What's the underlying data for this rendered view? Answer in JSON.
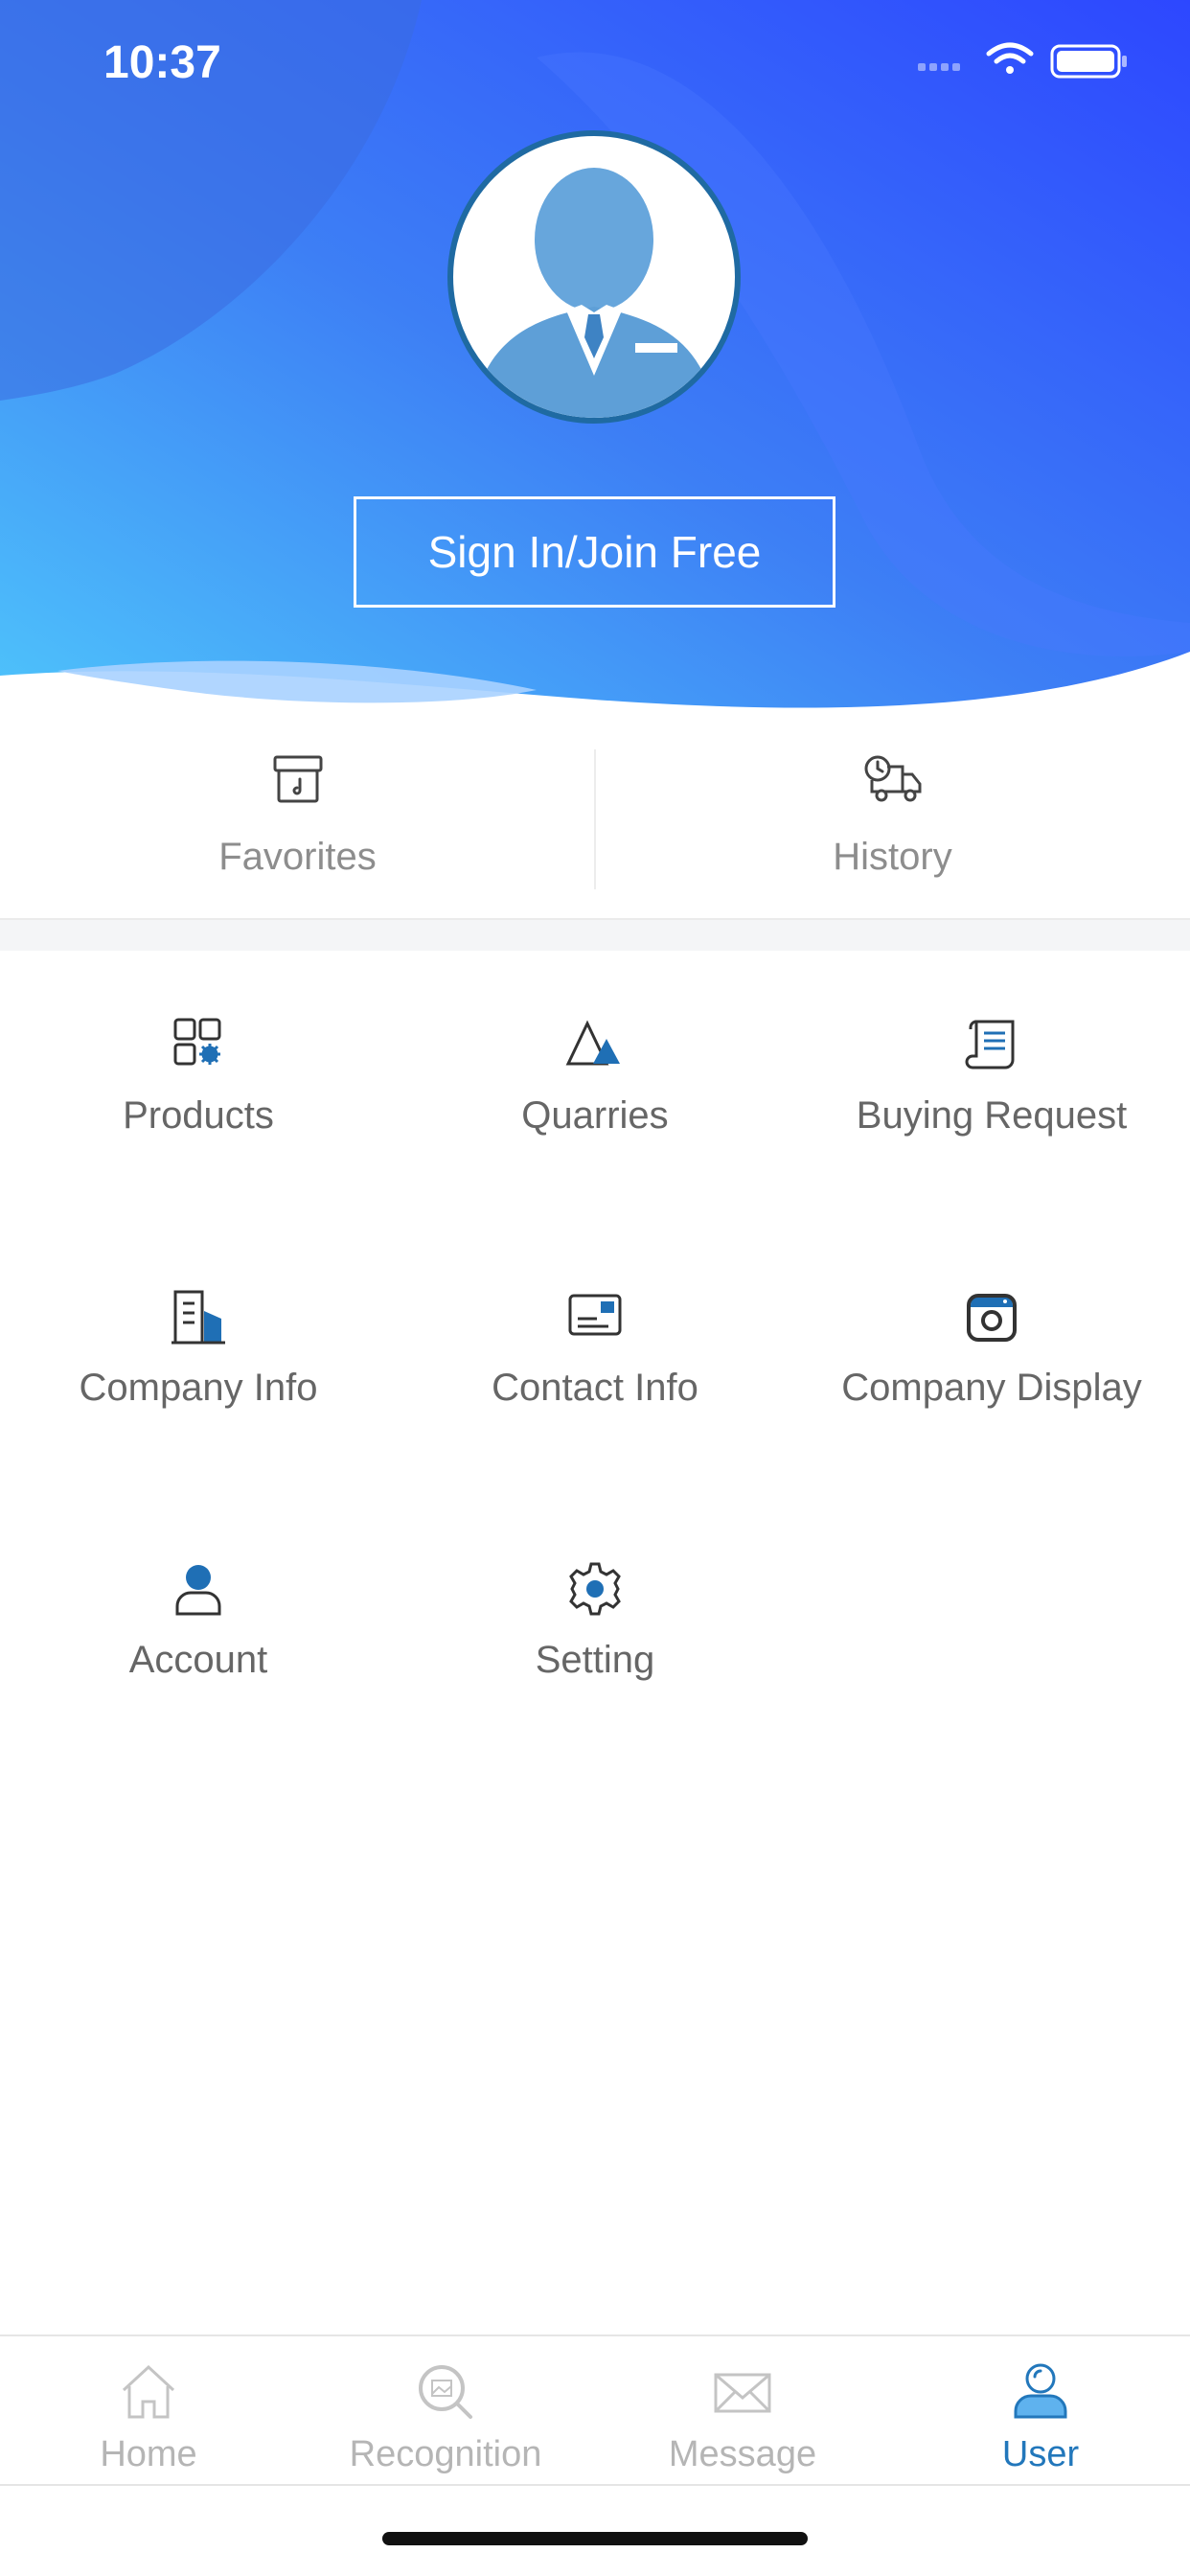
{
  "status_bar": {
    "time": "10:37"
  },
  "header": {
    "signin_label": "Sign In/Join Free"
  },
  "quick_links": [
    {
      "label": "Favorites",
      "icon": "archive-box-icon"
    },
    {
      "label": "History",
      "icon": "delivery-truck-clock-icon"
    }
  ],
  "menu": [
    {
      "label": "Products",
      "icon": "grid-gear-icon"
    },
    {
      "label": "Quarries",
      "icon": "mountain-icon"
    },
    {
      "label": "Buying Request",
      "icon": "scroll-document-icon"
    },
    {
      "label": "Company Info",
      "icon": "building-icon"
    },
    {
      "label": "Contact Info",
      "icon": "contact-card-icon"
    },
    {
      "label": "Company Display",
      "icon": "camera-icon"
    },
    {
      "label": "Account",
      "icon": "user-icon"
    },
    {
      "label": "Setting",
      "icon": "gear-icon"
    }
  ],
  "tabbar": [
    {
      "label": "Home",
      "icon": "house-icon",
      "active": false
    },
    {
      "label": "Recognition",
      "icon": "image-search-icon",
      "active": false
    },
    {
      "label": "Message",
      "icon": "envelope-icon",
      "active": false
    },
    {
      "label": "User",
      "icon": "user-icon",
      "active": true
    }
  ],
  "colors": {
    "accent": "#2277bb",
    "header_gradient_start": "#4ec3fb",
    "header_gradient_end": "#2d47ff",
    "icon_dark": "#333333"
  }
}
